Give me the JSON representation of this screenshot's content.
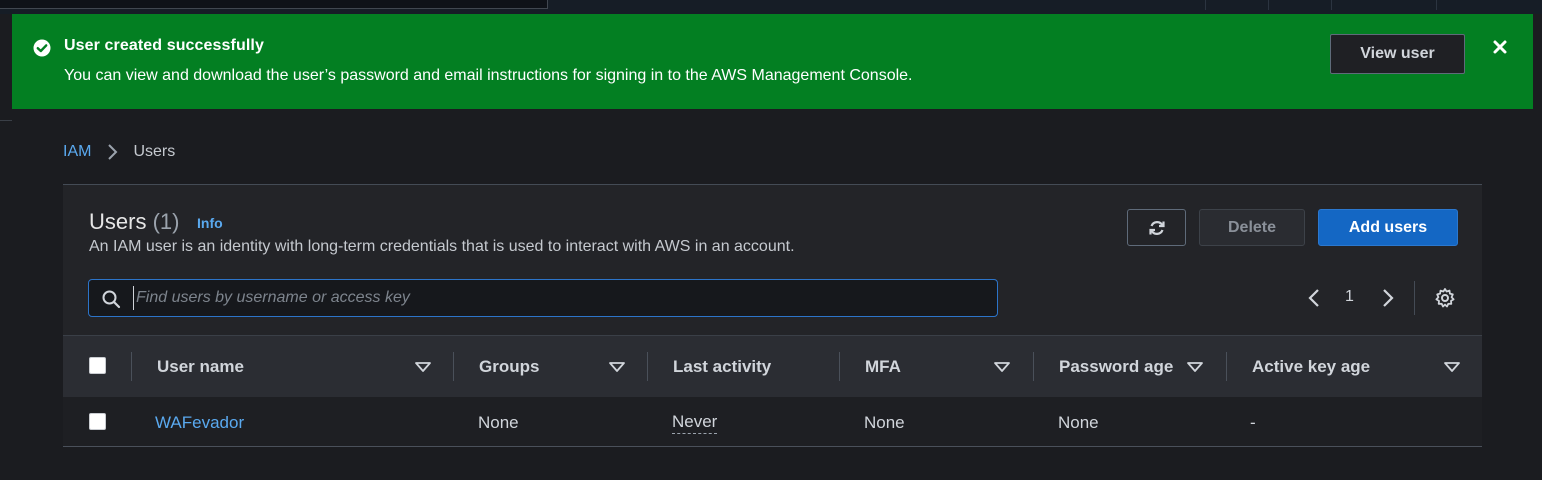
{
  "flash": {
    "title": "User created successfully",
    "message": "You can view and download the user’s password and email instructions for signing in to the AWS Management Console.",
    "view_button": "View user",
    "icons": {
      "status": "check-circle-icon",
      "close": "close-icon"
    },
    "color": "#037f22"
  },
  "breadcrumb": {
    "items": [
      "IAM",
      "Users"
    ]
  },
  "users_panel": {
    "title": "Users",
    "count": "(1)",
    "info_link": "Info",
    "description": "An IAM user is an identity with long-term credentials that is used to interact with AWS in an account.",
    "buttons": {
      "refresh_icon": "refresh-icon",
      "delete": "Delete",
      "add_users": "Add users"
    },
    "search": {
      "placeholder": "Find users by username or access key",
      "value": ""
    },
    "pagination": {
      "current_page": "1"
    }
  },
  "table": {
    "columns": [
      "User name",
      "Groups",
      "Last activity",
      "MFA",
      "Password age",
      "Active key age"
    ],
    "rows": [
      {
        "user_name": "WAFevador",
        "groups": "None",
        "last_activity": "Never",
        "mfa": "None",
        "password_age": "None",
        "active_key_age": "-"
      }
    ]
  },
  "colors": {
    "accent_blue": "#5aa9ef",
    "primary_button": "#1467c4",
    "background": "#1b1c20"
  }
}
